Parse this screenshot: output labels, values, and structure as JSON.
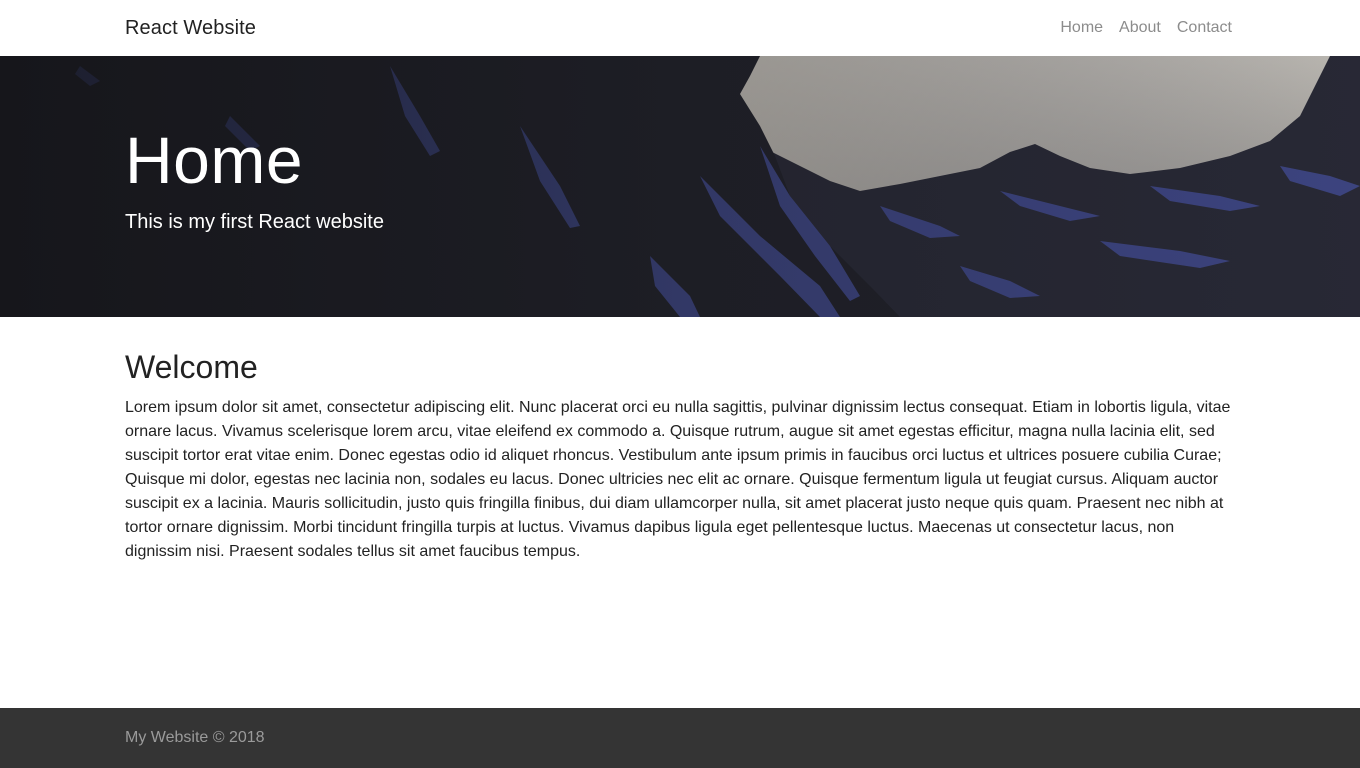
{
  "navbar": {
    "brand": "React Website",
    "links": [
      "Home",
      "About",
      "Contact"
    ]
  },
  "hero": {
    "title": "Home",
    "subtitle": "This is my first React website",
    "background": "mountain-landscape-image"
  },
  "content": {
    "heading": "Welcome",
    "paragraph": "Lorem ipsum dolor sit amet, consectetur adipiscing elit. Nunc placerat orci eu nulla sagittis, pulvinar dignissim lectus consequat. Etiam in lobortis ligula, vitae ornare lacus. Vivamus scelerisque lorem arcu, vitae eleifend ex commodo a. Quisque rutrum, augue sit amet egestas efficitur, magna nulla lacinia elit, sed suscipit tortor erat vitae enim. Donec egestas odio id aliquet rhoncus. Vestibulum ante ipsum primis in faucibus orci luctus et ultrices posuere cubilia Curae; Quisque mi dolor, egestas nec lacinia non, sodales eu lacus. Donec ultricies nec elit ac ornare. Quisque fermentum ligula ut feugiat cursus. Aliquam auctor suscipit ex a lacinia. Mauris sollicitudin, justo quis fringilla finibus, dui diam ullamcorper nulla, sit amet placerat justo neque quis quam. Praesent nec nibh at tortor ornare dignissim. Morbi tincidunt fringilla turpis at luctus. Vivamus dapibus ligula eget pellentesque luctus. Maecenas ut consectetur lacus, non dignissim nisi. Praesent sodales tellus sit amet faucibus tempus."
  },
  "footer": {
    "text": "My Website © 2018"
  },
  "colors": {
    "footer_bg": "#343434",
    "nav_link": "#8c8c8c",
    "text": "#222222"
  }
}
